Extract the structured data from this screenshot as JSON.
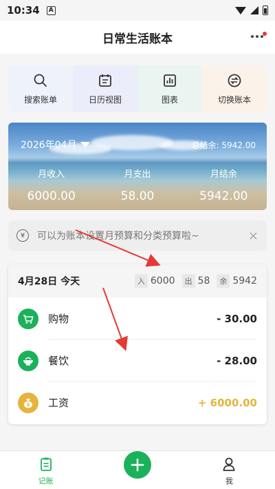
{
  "status_bar": {
    "time": "10:34",
    "a_badge": "A"
  },
  "header": {
    "title": "日常生活账本"
  },
  "quick_actions": [
    {
      "label": "搜索账单",
      "icon": "search-icon"
    },
    {
      "label": "日历视图",
      "icon": "calendar-icon"
    },
    {
      "label": "图表",
      "icon": "chart-icon"
    },
    {
      "label": "切换账本",
      "icon": "switch-icon"
    }
  ],
  "summary": {
    "month": "2026年04月",
    "total_balance": "总结余: 5942.00",
    "income_label": "月收入",
    "income_value": "6000.00",
    "expense_label": "月支出",
    "expense_value": "58.00",
    "balance_label": "月结余",
    "balance_value": "5942.00"
  },
  "tip": {
    "text": "可以为账本设置月预算和分类预算啦~",
    "coin": "¥",
    "close": "×"
  },
  "day": {
    "date": "4月28日 今天",
    "in_tag": "入",
    "in_value": "6000",
    "out_tag": "出",
    "out_value": "58",
    "bal_tag": "余",
    "bal_value": "5942"
  },
  "transactions": [
    {
      "name": "购物",
      "amount": "- 30.00",
      "icon": "cart-icon",
      "color": "#1bb15a",
      "amount_color": "#222"
    },
    {
      "name": "餐饮",
      "amount": "- 28.00",
      "icon": "bowl-icon",
      "color": "#1bb15a",
      "amount_color": "#222"
    },
    {
      "name": "工资",
      "amount": "+ 6000.00",
      "icon": "money-bag-icon",
      "color": "#e6b43c",
      "amount_color": "#e6b43c"
    }
  ],
  "tabbar": {
    "record_label": "记账",
    "me_label": "我"
  },
  "colors": {
    "accent": "#1bb15a",
    "income": "#e6b43c",
    "annotation_arrow": "#e53935"
  }
}
